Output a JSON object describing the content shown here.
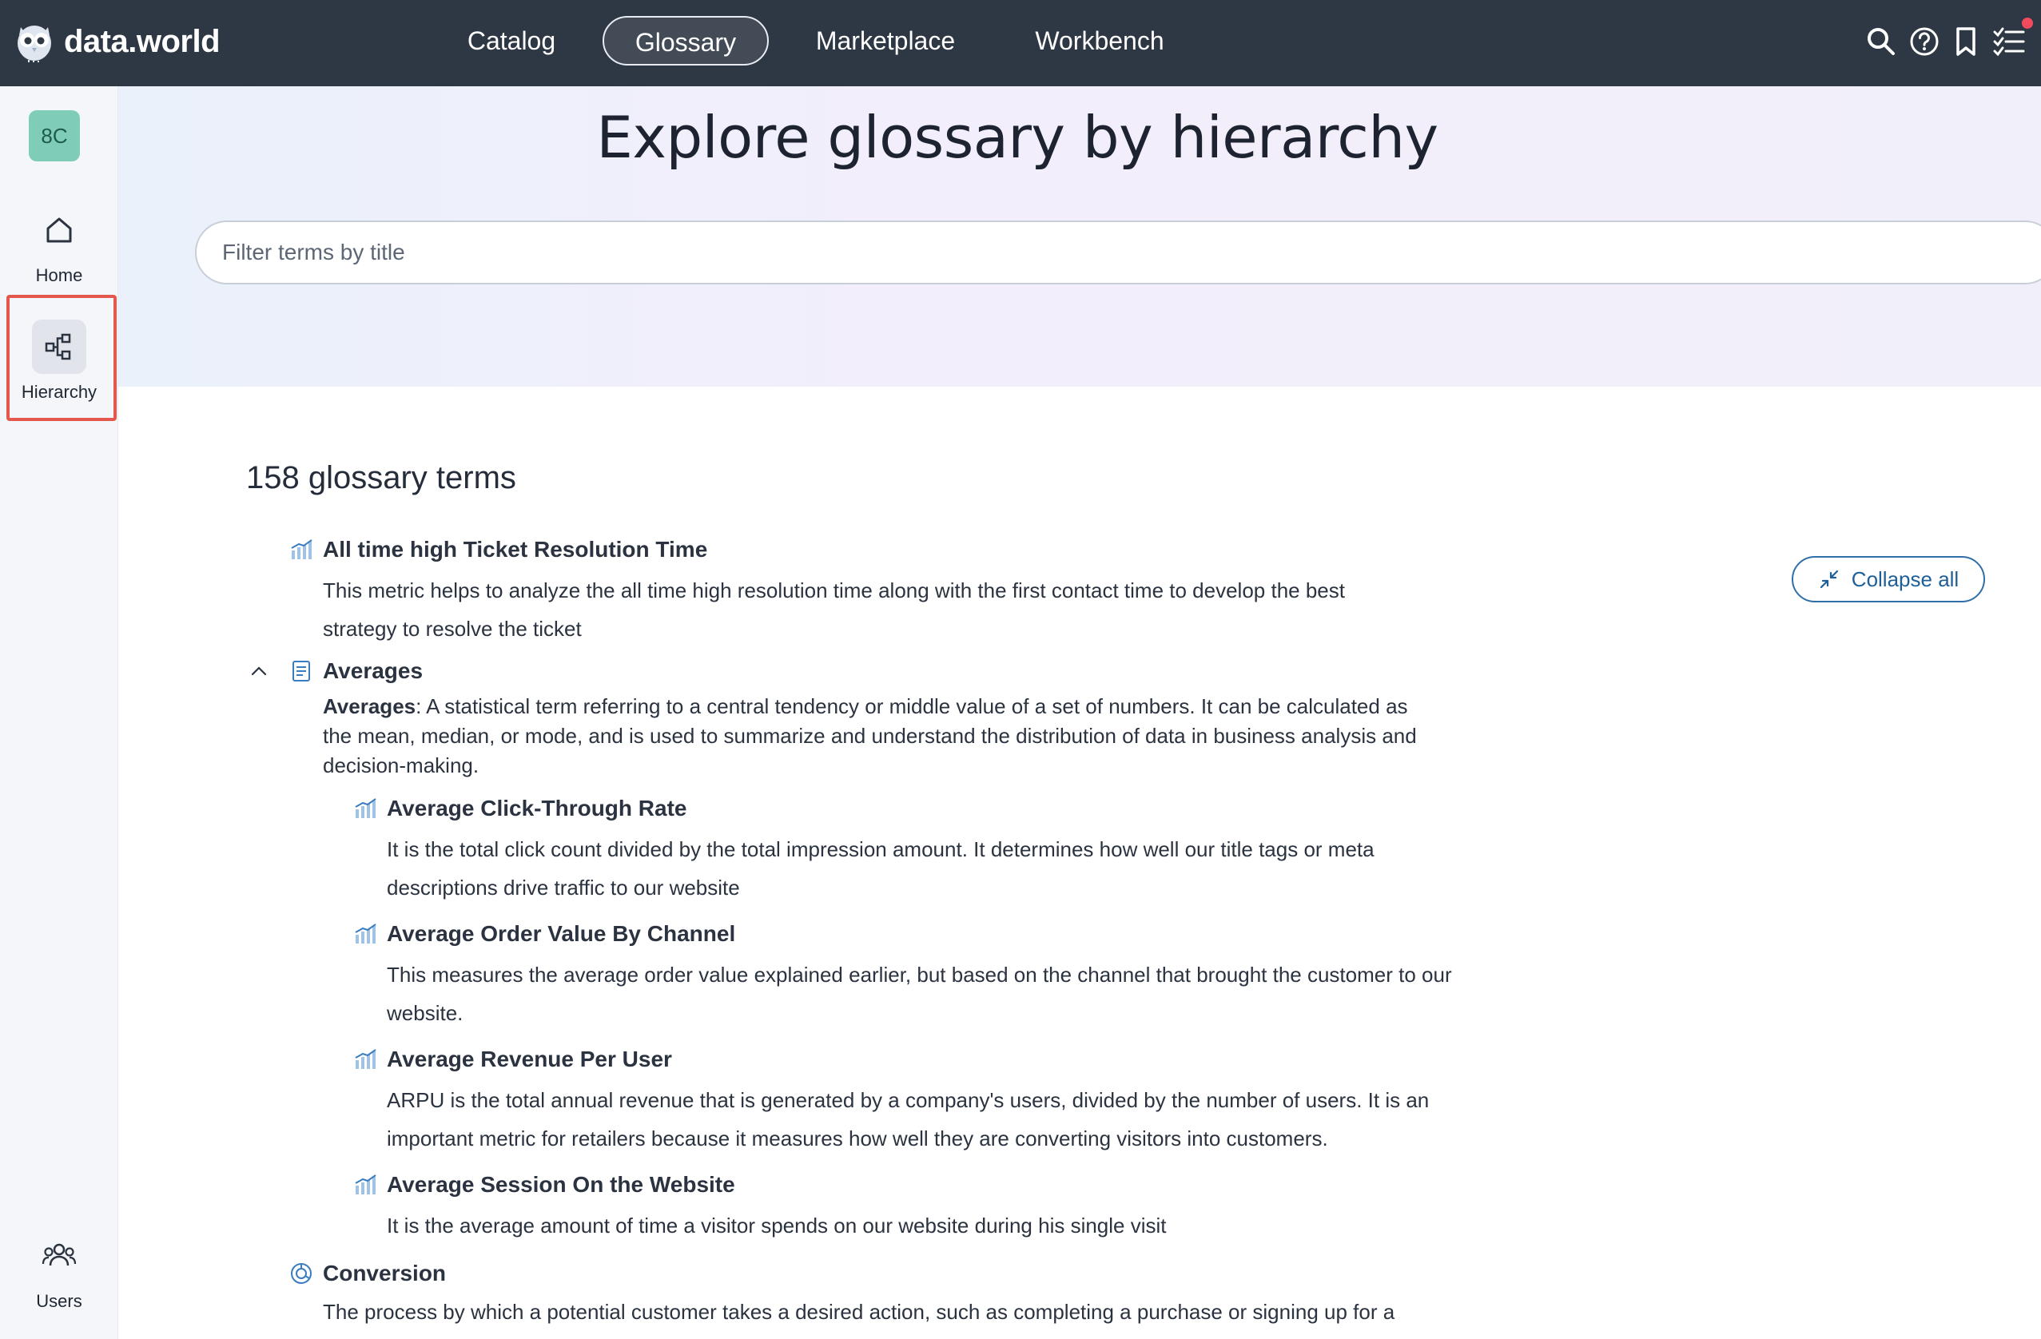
{
  "brand": {
    "name": "data.world"
  },
  "nav": {
    "items": [
      {
        "label": "Catalog"
      },
      {
        "label": "Glossary",
        "active": true
      },
      {
        "label": "Marketplace"
      },
      {
        "label": "Workbench"
      }
    ]
  },
  "top_icons": [
    "search-icon",
    "help-icon",
    "bookmark-icon",
    "tasks-icon"
  ],
  "sidebar": {
    "avatar": "8C",
    "items": [
      {
        "label": "Home",
        "icon": "home-icon"
      },
      {
        "label": "Hierarchy",
        "icon": "hierarchy-icon",
        "active": true
      },
      {
        "label": "Users",
        "icon": "users-icon"
      }
    ]
  },
  "hero": {
    "title": "Explore glossary by hierarchy",
    "filter_placeholder": "Filter terms by title"
  },
  "content": {
    "count_label": "158 glossary terms",
    "collapse_label": "Collapse all",
    "terms": [
      {
        "title": "All time high Ticket Resolution Time",
        "icon": "metric-icon",
        "desc_lines": [
          "This metric helps to analyze the all time high resolution time along with the first contact time to develop the best",
          "strategy to resolve the ticket"
        ]
      },
      {
        "title": "Averages",
        "icon": "document-icon",
        "expanded": true,
        "desc_bold": "Averages",
        "desc_lines": [
          ": A statistical term referring to a central tendency or middle value of a set of numbers. It can be calculated as",
          "the mean, median, or mode, and is used to summarize and understand the distribution of data in business analysis and",
          "decision-making."
        ],
        "children": [
          {
            "title": "Average Click-Through Rate",
            "icon": "metric-icon",
            "desc_lines": [
              "It is the total click count divided by the total impression amount. It determines how well our title tags or meta",
              "descriptions drive traffic to our website"
            ]
          },
          {
            "title": "Average Order Value By Channel",
            "icon": "metric-icon",
            "desc_lines": [
              "This measures the average order value explained earlier, but based on the channel that brought the customer to our",
              "website."
            ]
          },
          {
            "title": "Average Revenue Per User",
            "icon": "metric-icon",
            "desc_lines": [
              "ARPU is the total annual revenue that is generated by a company's users, divided by the number of users. It is an",
              "important metric for retailers because it measures how well they are converting visitors into customers."
            ]
          },
          {
            "title": "Average Session On the Website",
            "icon": "metric-icon",
            "desc_lines": [
              "It is the average amount of time a visitor spends on our website during his single visit"
            ]
          }
        ]
      },
      {
        "title": "Conversion",
        "icon": "concept-icon",
        "desc_lines": [
          "The process by which a potential customer takes a desired action, such as completing a purchase or signing up for a"
        ]
      }
    ]
  }
}
